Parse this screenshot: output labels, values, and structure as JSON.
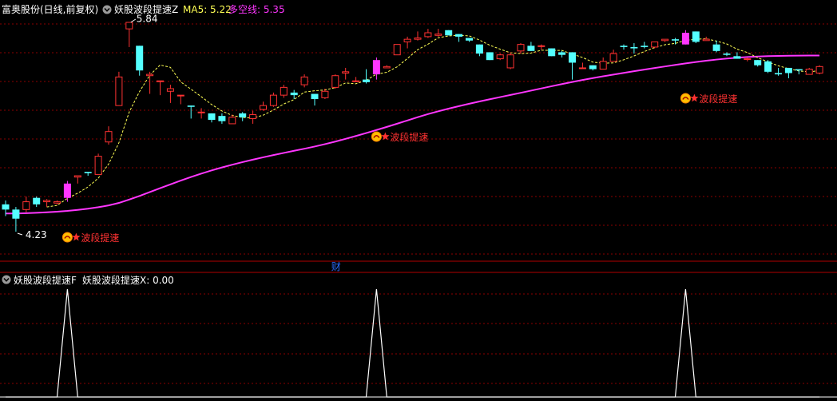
{
  "header": {
    "stock_label": "富奥股份(日线,前复权)",
    "indicator_name": "妖股波段提速Z",
    "ma5_label": "MA5: 5.22",
    "line_label": "多空线: 5.35"
  },
  "sub_header": {
    "indicator_name": "妖股波段提速F",
    "value_label": "妖股波段提速X: 0.00"
  },
  "high_marker": "5.84",
  "low_marker": "4.23",
  "signal_label": "波段提速",
  "finance_marker": "财",
  "colors": {
    "background": "#000000",
    "up": "#ff3232",
    "down": "#54ffff",
    "ma5": "#ffff54",
    "bull_bear_line": "#ff36ff",
    "grid": "#8b0000",
    "signal_text": "#ff3232",
    "finance_marker": "#2a6bff"
  },
  "icons": [
    "collapse-circle-icon",
    "signal-star-icon"
  ],
  "chart_data": [
    {
      "type": "candlestick",
      "series": [
        {
          "name": "Candles",
          "ohlc": [
            [
              4.44,
              4.4,
              4.47,
              4.35
            ],
            [
              4.4,
              4.33,
              4.42,
              4.23
            ],
            [
              4.4,
              4.46,
              4.5,
              4.38
            ],
            [
              4.49,
              4.44,
              4.5,
              4.42
            ],
            [
              4.46,
              4.47,
              4.48,
              4.42
            ],
            [
              4.45,
              4.46,
              4.47,
              4.44
            ],
            [
              4.49,
              4.6,
              4.62,
              4.46
            ],
            [
              4.65,
              4.66,
              4.66,
              4.6
            ],
            [
              4.69,
              4.68,
              4.69,
              4.66
            ],
            [
              4.67,
              4.81,
              4.83,
              4.67
            ],
            [
              4.92,
              5.0,
              5.04,
              4.9
            ],
            [
              5.2,
              5.42,
              5.46,
              5.2
            ],
            [
              5.79,
              5.84,
              5.84,
              5.65
            ],
            [
              5.66,
              5.47,
              5.66,
              5.43
            ],
            [
              5.43,
              5.44,
              5.46,
              5.29
            ],
            [
              5.39,
              5.39,
              5.39,
              5.28
            ],
            [
              5.31,
              5.33,
              5.36,
              5.22
            ],
            [
              5.28,
              5.28,
              5.28,
              5.21
            ],
            [
              5.2,
              5.19,
              5.2,
              5.1
            ],
            [
              5.15,
              5.15,
              5.18,
              5.1
            ],
            [
              5.14,
              5.09,
              5.14,
              5.07
            ],
            [
              5.12,
              5.08,
              5.14,
              5.06
            ],
            [
              5.06,
              5.11,
              5.13,
              5.06
            ],
            [
              5.14,
              5.11,
              5.15,
              5.08
            ],
            [
              5.1,
              5.13,
              5.16,
              5.06
            ],
            [
              5.17,
              5.2,
              5.23,
              5.16
            ],
            [
              5.2,
              5.28,
              5.3,
              5.19
            ],
            [
              5.28,
              5.34,
              5.36,
              5.26
            ],
            [
              5.3,
              5.28,
              5.32,
              5.25
            ],
            [
              5.36,
              5.42,
              5.44,
              5.34
            ],
            [
              5.29,
              5.25,
              5.29,
              5.2
            ],
            [
              5.26,
              5.31,
              5.33,
              5.25
            ],
            [
              5.34,
              5.43,
              5.44,
              5.33
            ],
            [
              5.45,
              5.46,
              5.49,
              5.4
            ],
            [
              5.39,
              5.39,
              5.42,
              5.38
            ],
            [
              5.4,
              5.38,
              5.48,
              5.37
            ],
            [
              5.44,
              5.55,
              5.57,
              5.4
            ],
            [
              5.49,
              5.5,
              5.51,
              5.49
            ],
            [
              5.59,
              5.67,
              5.67,
              5.59
            ],
            [
              5.69,
              5.71,
              5.73,
              5.64
            ],
            [
              5.71,
              5.72,
              5.77,
              5.7
            ],
            [
              5.73,
              5.76,
              5.79,
              5.72
            ],
            [
              5.74,
              5.75,
              5.79,
              5.73
            ],
            [
              5.78,
              5.74,
              5.78,
              5.74
            ],
            [
              5.75,
              5.73,
              5.75,
              5.69
            ],
            [
              5.72,
              5.7,
              5.72,
              5.69
            ],
            [
              5.67,
              5.6,
              5.67,
              5.58
            ],
            [
              5.61,
              5.55,
              5.61,
              5.55
            ],
            [
              5.56,
              5.59,
              5.6,
              5.55
            ],
            [
              5.49,
              5.59,
              5.61,
              5.48
            ],
            [
              5.62,
              5.67,
              5.68,
              5.6
            ],
            [
              5.66,
              5.62,
              5.69,
              5.62
            ],
            [
              5.66,
              5.66,
              5.67,
              5.63
            ],
            [
              5.64,
              5.58,
              5.64,
              5.58
            ],
            [
              5.61,
              5.59,
              5.62,
              5.57
            ],
            [
              5.61,
              5.53,
              5.61,
              5.4
            ],
            [
              5.49,
              5.49,
              5.53,
              5.49
            ],
            [
              5.51,
              5.48,
              5.51,
              5.47
            ],
            [
              5.48,
              5.54,
              5.57,
              5.48
            ],
            [
              5.54,
              5.6,
              5.63,
              5.54
            ],
            [
              5.66,
              5.65,
              5.67,
              5.63
            ],
            [
              5.65,
              5.64,
              5.68,
              5.6
            ],
            [
              5.66,
              5.65,
              5.69,
              5.64
            ],
            [
              5.65,
              5.69,
              5.69,
              5.64
            ],
            [
              5.7,
              5.71,
              5.71,
              5.69
            ],
            [
              5.71,
              5.7,
              5.72,
              5.67
            ],
            [
              5.67,
              5.76,
              5.78,
              5.67
            ],
            [
              5.77,
              5.69,
              5.77,
              5.68
            ],
            [
              5.7,
              5.71,
              5.73,
              5.7
            ],
            [
              5.67,
              5.62,
              5.7,
              5.61
            ],
            [
              5.6,
              5.59,
              5.61,
              5.58
            ],
            [
              5.58,
              5.56,
              5.61,
              5.56
            ],
            [
              5.56,
              5.56,
              5.57,
              5.54
            ],
            [
              5.55,
              5.51,
              5.55,
              5.5
            ],
            [
              5.54,
              5.46,
              5.55,
              5.45
            ],
            [
              5.45,
              5.44,
              5.49,
              5.43
            ],
            [
              5.49,
              5.45,
              5.49,
              5.41
            ],
            [
              5.48,
              5.47,
              5.48,
              5.44
            ],
            [
              5.44,
              5.48,
              5.49,
              5.44
            ],
            [
              5.45,
              5.5,
              5.51,
              5.44
            ]
          ]
        },
        {
          "name": "MA5",
          "values": []
        },
        {
          "name": "多空线",
          "values": []
        }
      ],
      "signals": [
        6,
        36,
        66
      ],
      "finance_marker_index": 32
    },
    {
      "type": "line",
      "series": [
        {
          "name": "妖股波段提速X",
          "values": [
            0,
            0,
            0,
            0,
            0,
            0,
            1,
            0,
            0,
            0,
            0,
            0,
            0,
            0,
            0,
            0,
            0,
            0,
            0,
            0,
            0,
            0,
            0,
            0,
            0,
            0,
            0,
            0,
            0,
            0,
            0,
            0,
            0,
            0,
            0,
            0,
            1,
            0,
            0,
            0,
            0,
            0,
            0,
            0,
            0,
            0,
            0,
            0,
            0,
            0,
            0,
            0,
            0,
            0,
            0,
            0,
            0,
            0,
            0,
            0,
            0,
            0,
            0,
            0,
            0,
            0,
            1,
            0,
            0,
            0,
            0,
            0,
            0,
            0,
            0,
            0,
            0,
            0,
            0,
            0
          ]
        }
      ],
      "ylim": [
        0,
        1
      ]
    }
  ]
}
